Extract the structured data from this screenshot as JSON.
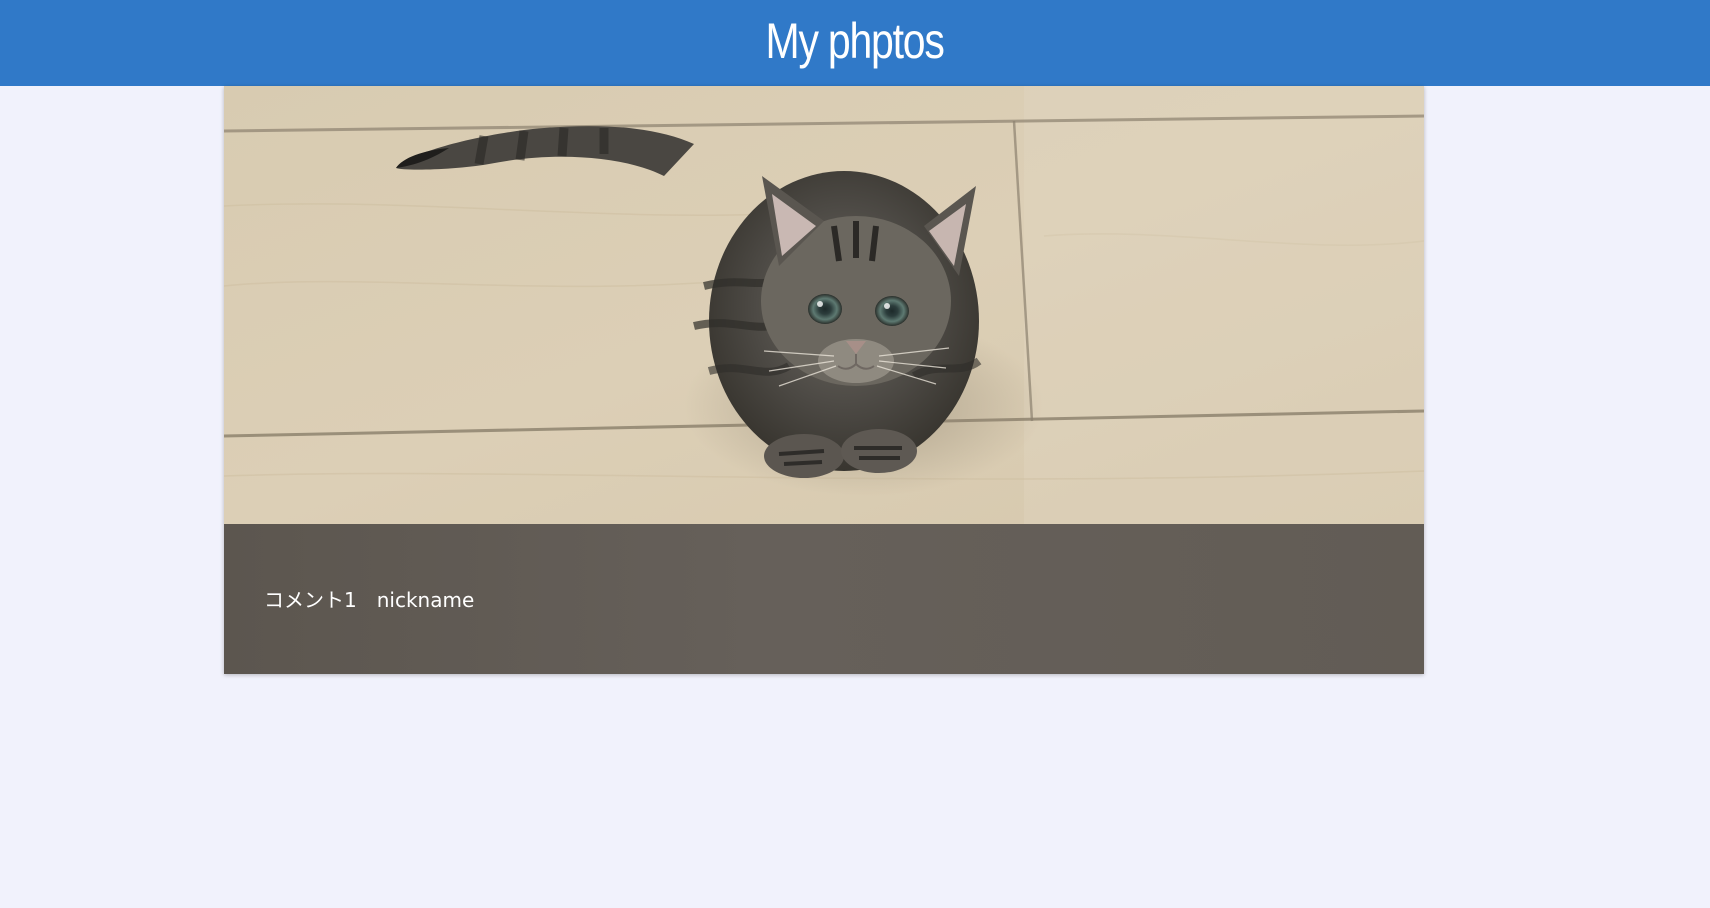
{
  "header": {
    "title": "My phptos",
    "background_color": "#3079c8"
  },
  "post": {
    "image_subject": "kitten-photo",
    "comment": "コメント1",
    "nickname": "nickname"
  },
  "colors": {
    "page_background": "#f1f2fc",
    "caption_background": "#66605a"
  }
}
